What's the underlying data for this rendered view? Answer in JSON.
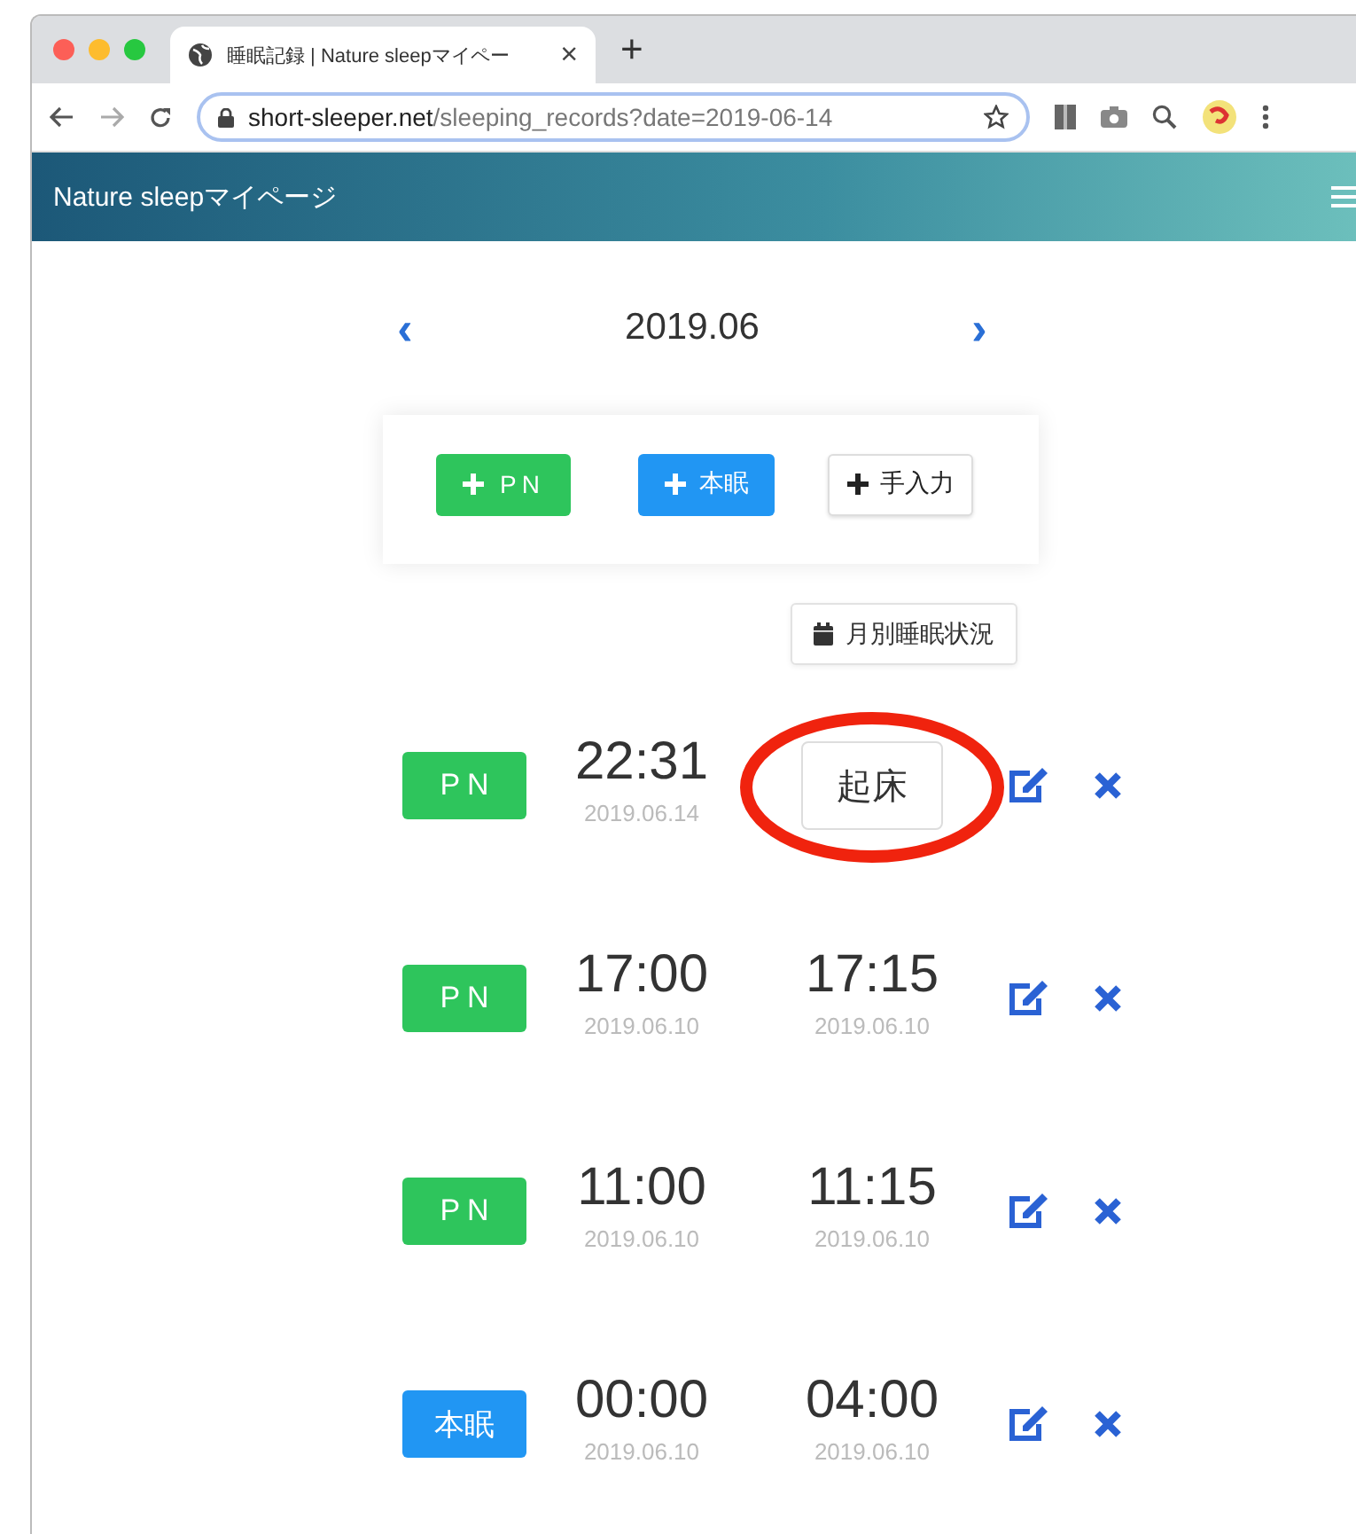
{
  "browser": {
    "tab": {
      "title": "睡眠記録 | Nature sleepマイペー",
      "close": "×"
    },
    "new_tab": "+",
    "url": {
      "host": "short-sleeper.net",
      "path": "/sleeping_records?date=2019-06-14"
    }
  },
  "navbar": {
    "brand": "Nature sleepマイページ"
  },
  "month_nav": {
    "prev": "‹",
    "title": "2019.06",
    "next": "›"
  },
  "actions": [
    {
      "kind": "pn",
      "label": "PN"
    },
    {
      "kind": "main",
      "label": "本眠"
    },
    {
      "kind": "manual",
      "label": "手入力"
    }
  ],
  "monthly_button": "月別睡眠状況",
  "records": [
    {
      "type": {
        "kind": "pn",
        "label": "PN"
      },
      "start": {
        "time": "22:31",
        "date": "2019.06.14"
      },
      "end": {
        "kind": "button",
        "label": "起床"
      },
      "highlighted": true
    },
    {
      "type": {
        "kind": "pn",
        "label": "PN"
      },
      "start": {
        "time": "17:00",
        "date": "2019.06.10"
      },
      "end": {
        "kind": "time",
        "time": "17:15",
        "date": "2019.06.10"
      },
      "highlighted": false
    },
    {
      "type": {
        "kind": "pn",
        "label": "PN"
      },
      "start": {
        "time": "11:00",
        "date": "2019.06.10"
      },
      "end": {
        "kind": "time",
        "time": "11:15",
        "date": "2019.06.10"
      },
      "highlighted": false
    },
    {
      "type": {
        "kind": "main",
        "label": "本眠"
      },
      "start": {
        "time": "00:00",
        "date": "2019.06.10"
      },
      "end": {
        "kind": "time",
        "time": "04:00",
        "date": "2019.06.10"
      },
      "highlighted": false
    }
  ]
}
